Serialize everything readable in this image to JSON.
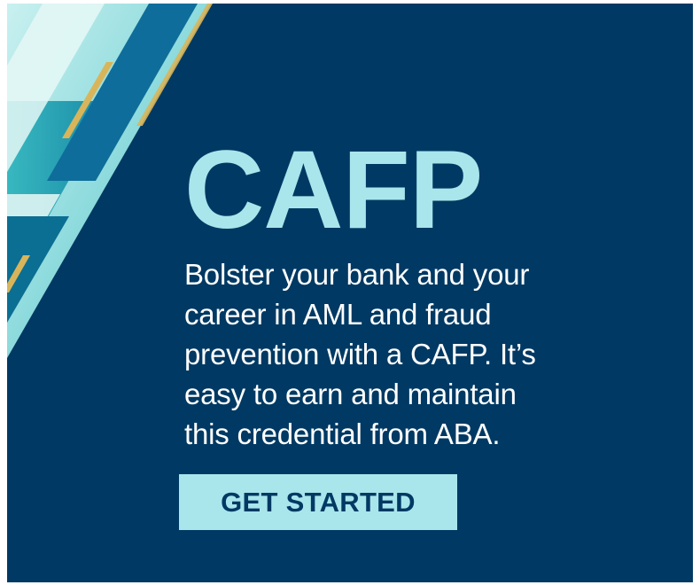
{
  "ad": {
    "headline": "CAFP",
    "body_lines": [
      "Bolster your bank and your",
      "career in AML and fraud",
      "prevention with a CAFP. It’s",
      "easy to earn and maintain",
      "this credential from ABA."
    ],
    "cta_label": "GET STARTED"
  },
  "colors": {
    "background": "#003963",
    "accent": "#a8e6ec",
    "text": "#ffffff",
    "teal": "#1aa8b8",
    "gold": "#d8b55a"
  },
  "icons": [
    "decorative-stripes-graphic"
  ]
}
